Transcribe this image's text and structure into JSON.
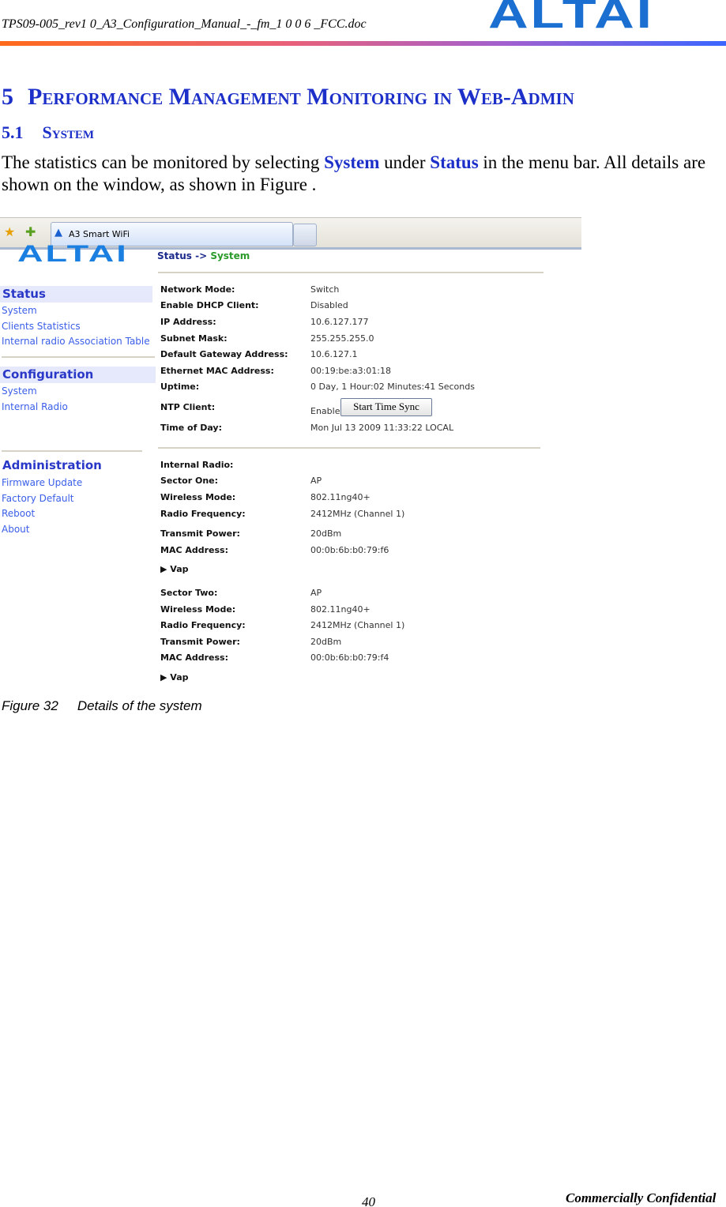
{
  "header": {
    "filename": "TPS09-005_rev1 0_A3_Configuration_Manual_-_fm_1 0 0 6 _FCC.doc",
    "logo": "ALTAI"
  },
  "section": {
    "number": "5",
    "title": "Performance Management Monitoring in Web-Admin"
  },
  "subsection": {
    "number": "5.1",
    "title": "System"
  },
  "intro": {
    "part1": "The statistics can be monitored by selecting ",
    "system": "System",
    "part2": " under ",
    "status": "Status",
    "part3": " in the menu bar. All details are shown on the window, as shown in Figure ."
  },
  "screenshot": {
    "tab_title": "A3 Smart WiFi",
    "logo": "ALTAI",
    "breadcrumb": {
      "parent": "Status",
      "arrow": "->",
      "current": "System"
    },
    "nav": {
      "status": {
        "title": "Status",
        "items": [
          "System",
          "Clients Statistics",
          "Internal radio Association Table"
        ]
      },
      "configuration": {
        "title": "Configuration",
        "items": [
          "System",
          "Internal Radio"
        ]
      },
      "administration": {
        "title": "Administration",
        "items": [
          "Firmware Update",
          "Factory Default",
          "Reboot",
          "About"
        ]
      }
    },
    "system_info": [
      {
        "label": "Network Mode:",
        "value": "Switch"
      },
      {
        "label": "Enable DHCP Client:",
        "value": "Disabled"
      },
      {
        "label": "IP Address:",
        "value": "10.6.127.177"
      },
      {
        "label": "Subnet Mask:",
        "value": "255.255.255.0"
      },
      {
        "label": "Default Gateway Address:",
        "value": "10.6.127.1"
      },
      {
        "label": "Ethernet MAC Address:",
        "value": "00:19:be:a3:01:18"
      },
      {
        "label": "Uptime:",
        "value": "0 Day, 1 Hour:02 Minutes:41 Seconds"
      },
      {
        "label": "NTP Client:",
        "value": "Enable"
      },
      {
        "label": "Time of Day:",
        "value": "Mon Jul 13 2009 11:33:22 LOCAL"
      }
    ],
    "ntp_button": "Start Time Sync",
    "radio_info": [
      {
        "label": "Internal Radio:",
        "value": ""
      },
      {
        "label": "Sector One:",
        "value": "AP"
      },
      {
        "label": "Wireless Mode:",
        "value": "802.11ng40+"
      },
      {
        "label": "Radio Frequency:",
        "value": "2412MHz (Channel 1)"
      },
      {
        "label": "Transmit Power:",
        "value": "20dBm"
      },
      {
        "label": "MAC Address:",
        "value": "00:0b:6b:b0:79:f6"
      },
      {
        "label": "▶ Vap",
        "value": ""
      },
      {
        "label": "Sector Two:",
        "value": "AP"
      },
      {
        "label": "Wireless Mode:",
        "value": "802.11ng40+"
      },
      {
        "label": "Radio Frequency:",
        "value": "2412MHz (Channel 1)"
      },
      {
        "label": "Transmit Power:",
        "value": "20dBm"
      },
      {
        "label": "MAC Address:",
        "value": "00:0b:6b:b0:79:f4"
      },
      {
        "label": "▶ Vap",
        "value": ""
      }
    ]
  },
  "caption": {
    "number": "Figure 32",
    "text": "Details of the system"
  },
  "footer": {
    "page": "40",
    "confidential": "Commercially Confidential"
  }
}
